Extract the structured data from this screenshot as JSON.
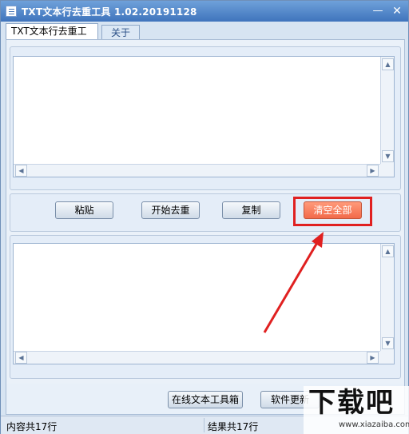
{
  "window": {
    "title": "TXT文本行去重工具 1.02.20191128",
    "min_glyph": "—",
    "close_glyph": "✕"
  },
  "tabs": [
    {
      "label": "TXT文本行去重工具"
    },
    {
      "label": "关于"
    }
  ],
  "buttons": {
    "paste": "粘贴",
    "start": "开始去重",
    "copy": "复制",
    "clear": "清空全部",
    "online": "在线文本工具箱",
    "update": "软件更新"
  },
  "status": {
    "left": "内容共17行",
    "right": "结果共17行"
  },
  "watermark": {
    "main": "下载吧",
    "sub": "www.xiazaiba.com"
  },
  "colors": {
    "titlebar": "#4f84c8",
    "accent_clear": "#f26a4a",
    "annotation": "#e02020"
  },
  "icons": {
    "scroll_up": "▲",
    "scroll_down": "▼",
    "scroll_left": "◀",
    "scroll_right": "▶"
  }
}
